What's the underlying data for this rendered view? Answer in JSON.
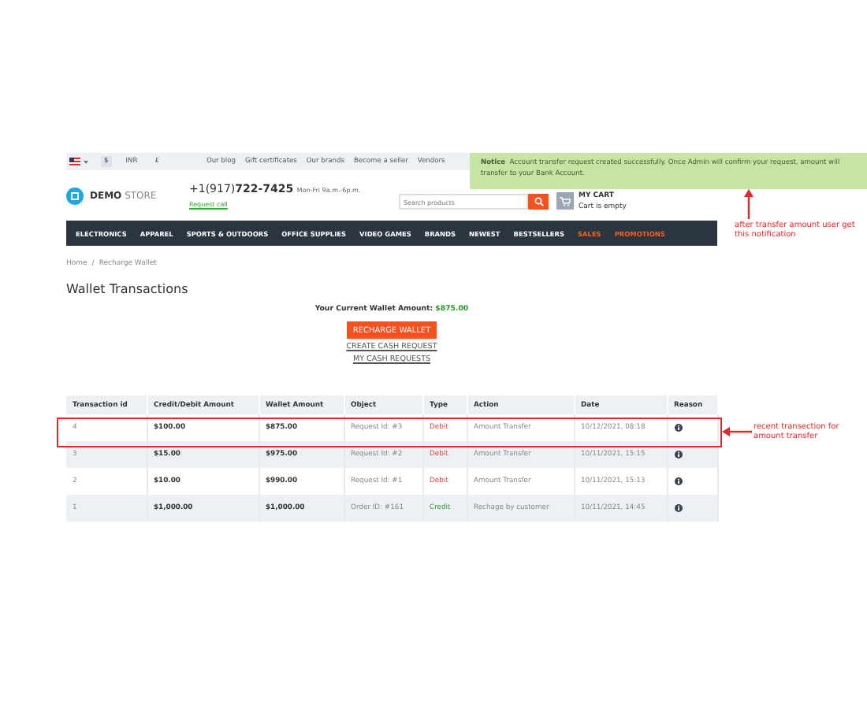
{
  "top_bar": {
    "currencies": [
      {
        "label": "$",
        "selected": true
      },
      {
        "label": "INR",
        "selected": false
      },
      {
        "label": "£",
        "selected": false
      }
    ],
    "links": [
      "Our blog",
      "Gift certificates",
      "Our brands",
      "Become a seller",
      "Vendors"
    ]
  },
  "header": {
    "logo_bold": "DEMO",
    "logo_light": "STORE",
    "phone_prefix": "+1(917)",
    "phone_number": "722-7425",
    "hours": "Mon-Fri 9a.m.-6p.m.",
    "request_call": "Request call",
    "search": {
      "placeholder": "Search products"
    },
    "cart_title": "MY CART",
    "cart_status": "Cart is empty"
  },
  "nav": [
    {
      "label": "ELECTRONICS",
      "highlighted": false
    },
    {
      "label": "APPAREL",
      "highlighted": false
    },
    {
      "label": "SPORTS & OUTDOORS",
      "highlighted": false
    },
    {
      "label": "OFFICE SUPPLIES",
      "highlighted": false
    },
    {
      "label": "VIDEO GAMES",
      "highlighted": false
    },
    {
      "label": "BRANDS",
      "highlighted": false
    },
    {
      "label": "NEWEST",
      "highlighted": false
    },
    {
      "label": "BESTSELLERS",
      "highlighted": false
    },
    {
      "label": "SALES",
      "highlighted": true
    },
    {
      "label": "PROMOTIONS",
      "highlighted": true
    }
  ],
  "breadcrumb": {
    "items": [
      "Home",
      "Recharge Wallet"
    ],
    "separator": "/"
  },
  "title": "Wallet Transactions",
  "wallet": {
    "label": "Your Current Wallet Amount:",
    "amount": "$875.00",
    "recharge_button": "RECHARGE WALLET",
    "links": [
      "CREATE CASH REQUEST",
      "MY CASH REQUESTS"
    ]
  },
  "table": {
    "columns": [
      "Transaction id",
      "Credit/Debit Amount",
      "Wallet Amount",
      "Object",
      "Type",
      "Action",
      "Date",
      "Reason"
    ],
    "rows": [
      {
        "id": "4",
        "amount": "$100.00",
        "wallet": "$875.00",
        "object": "Request Id: #3",
        "type": "Debit",
        "kind": "debit",
        "action": "Amount Transfer",
        "date": "10/12/2021, 08:18"
      },
      {
        "id": "3",
        "amount": "$15.00",
        "wallet": "$975.00",
        "object": "Request Id: #2",
        "type": "Debit",
        "kind": "debit",
        "action": "Amount Transfer",
        "date": "10/11/2021, 15:15"
      },
      {
        "id": "2",
        "amount": "$10.00",
        "wallet": "$990.00",
        "object": "Request Id: #1",
        "type": "Debit",
        "kind": "debit",
        "action": "Amount Transfer",
        "date": "10/11/2021, 15:13"
      },
      {
        "id": "1",
        "amount": "$1,000.00",
        "wallet": "$1,000.00",
        "object": "Order ID: #161",
        "type": "Credit",
        "kind": "credit",
        "action": "Rechage by customer",
        "date": "10/11/2021, 14:45"
      }
    ]
  },
  "notice": {
    "label": "Notice",
    "message": "Account transfer request created successfully. Once Admin will confirm your request, amount will transfer to your Bank Account."
  },
  "annotations": [
    {
      "text": "after transfer amount user get this notification"
    },
    {
      "text": "recent transection for amount transfer"
    }
  ]
}
